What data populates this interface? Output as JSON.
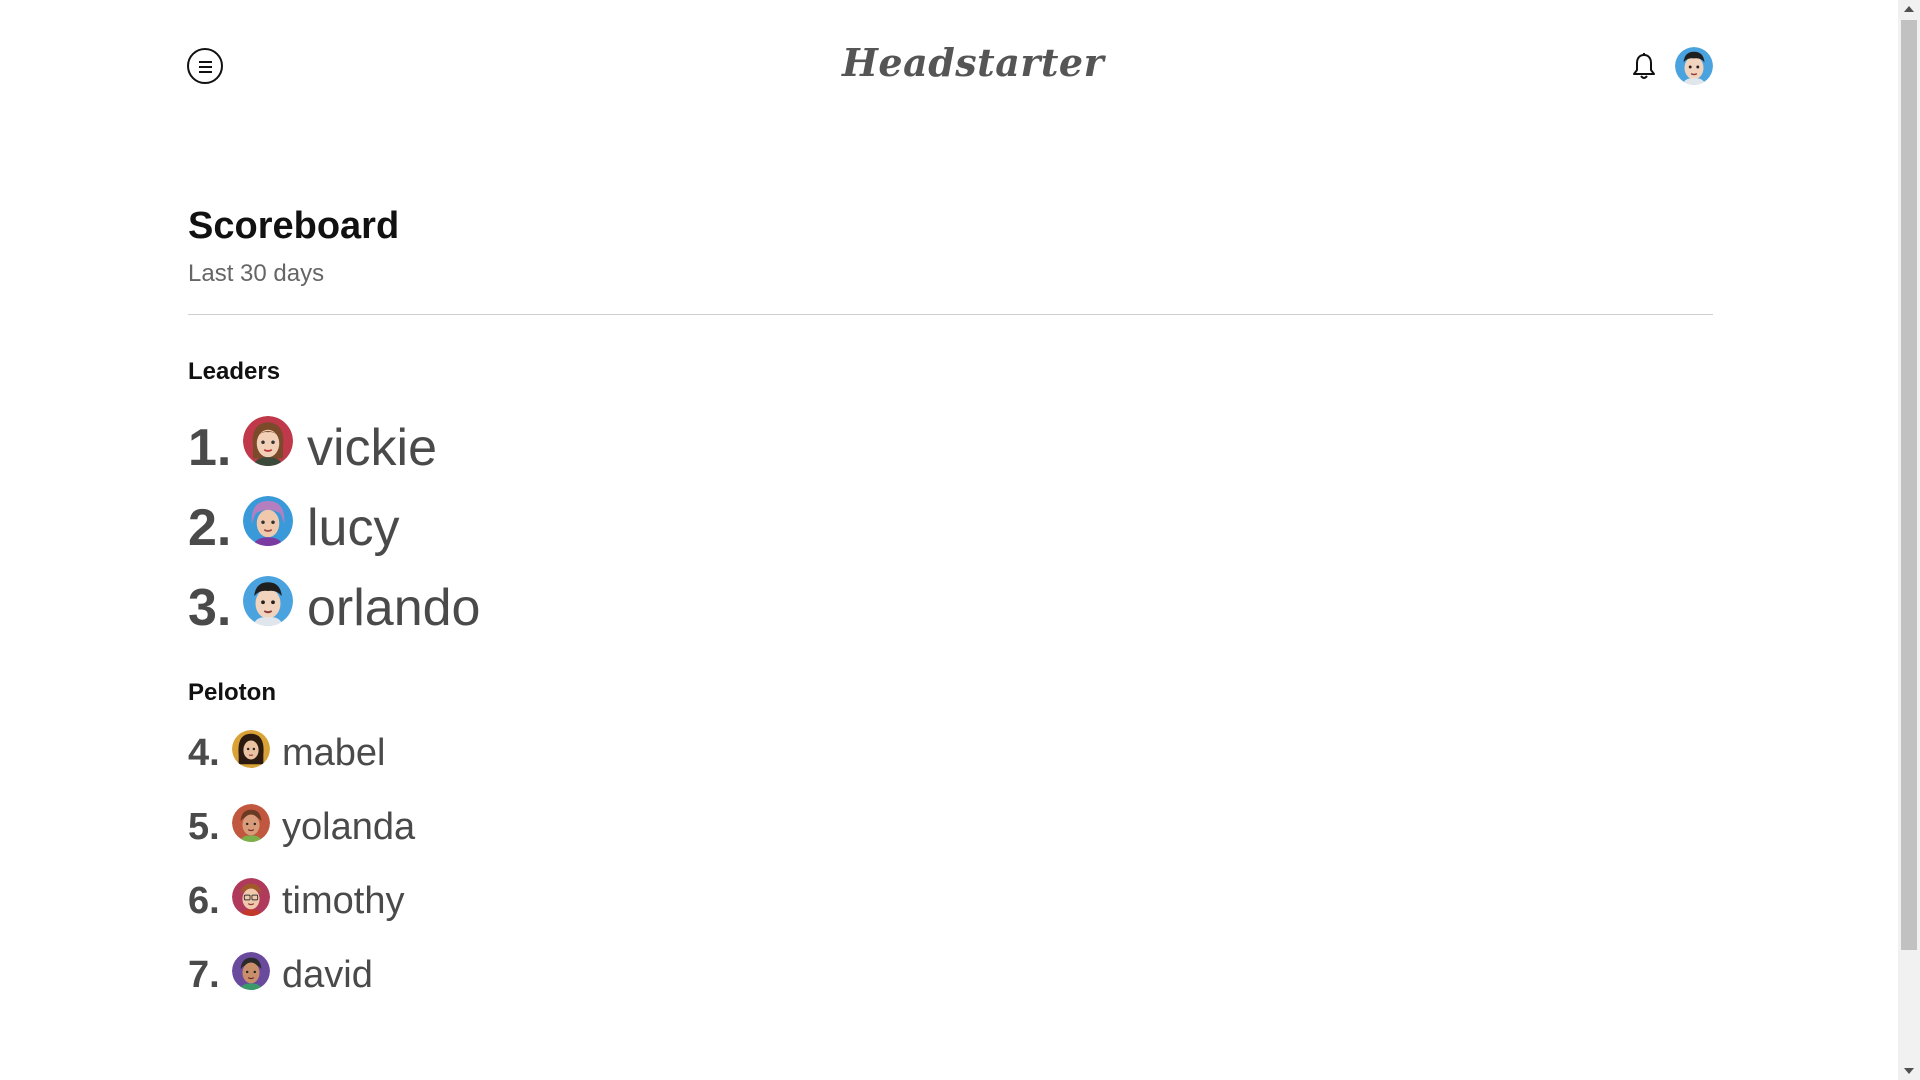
{
  "header": {
    "logo_text": "Headstarter",
    "menu_icon": "hamburger-menu-icon",
    "notification_icon": "bell-icon",
    "profile_icon": "user-avatar"
  },
  "scoreboard": {
    "title": "Scoreboard",
    "subtitle": "Last 30 days",
    "leaders_heading": "Leaders",
    "peloton_heading": "Peloton",
    "leaders": [
      {
        "rank": "1.",
        "name": "vickie",
        "avatar_bg": "#c0394b"
      },
      {
        "rank": "2.",
        "name": "lucy",
        "avatar_bg": "#3a9ad9"
      },
      {
        "rank": "3.",
        "name": "orlando",
        "avatar_bg": "#4aa3df"
      }
    ],
    "peloton": [
      {
        "rank": "4.",
        "name": "mabel",
        "avatar_bg": "#d8a237"
      },
      {
        "rank": "5.",
        "name": "yolanda",
        "avatar_bg": "#c0573e"
      },
      {
        "rank": "6.",
        "name": "timothy",
        "avatar_bg": "#b03a5b"
      },
      {
        "rank": "7.",
        "name": "david",
        "avatar_bg": "#6a4a9c"
      }
    ]
  },
  "colors": {
    "text_dark": "#111111",
    "text_muted": "#666666",
    "name_text": "#4a4a4a",
    "divider": "#cfcfcf"
  }
}
